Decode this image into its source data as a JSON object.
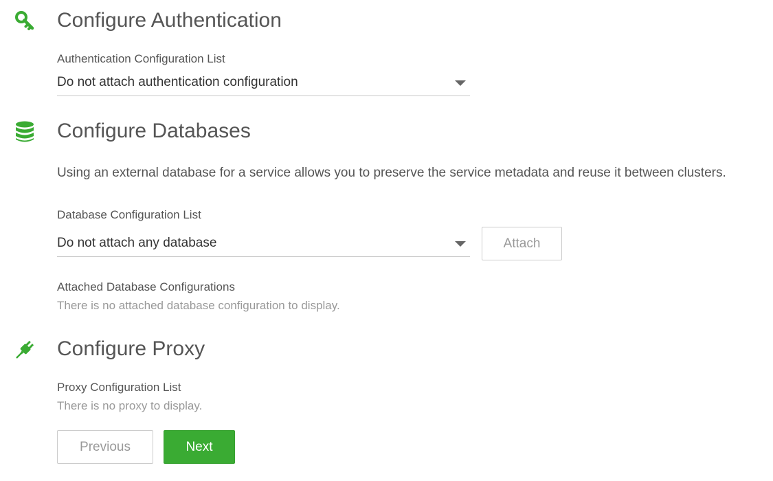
{
  "colors": {
    "accent": "#3aab33",
    "title_text": "#555555",
    "muted_text": "#999999"
  },
  "authentication": {
    "icon": "key-icon",
    "title": "Configure Authentication",
    "list_label": "Authentication Configuration List",
    "selected_value": "Do not attach authentication configuration"
  },
  "databases": {
    "icon": "database-icon",
    "title": "Configure Databases",
    "description": "Using an external database for a service allows you to preserve the service metadata and reuse it between clusters.",
    "list_label": "Database Configuration List",
    "selected_value": "Do not attach any database",
    "attach_button": "Attach",
    "attached_label": "Attached Database Configurations",
    "attached_empty": "There is no attached database configuration to display."
  },
  "proxy": {
    "icon": "plug-icon",
    "title": "Configure Proxy",
    "list_label": "Proxy Configuration List",
    "empty_text": "There is no proxy to display."
  },
  "navigation": {
    "previous_label": "Previous",
    "next_label": "Next"
  }
}
